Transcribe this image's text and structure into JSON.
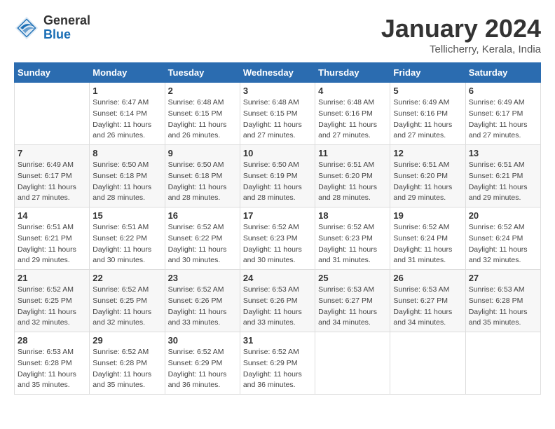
{
  "logo": {
    "general": "General",
    "blue": "Blue"
  },
  "title": "January 2024",
  "subtitle": "Tellicherry, Kerala, India",
  "days_of_week": [
    "Sunday",
    "Monday",
    "Tuesday",
    "Wednesday",
    "Thursday",
    "Friday",
    "Saturday"
  ],
  "weeks": [
    [
      {
        "day": "",
        "sunrise": "",
        "sunset": "",
        "daylight": ""
      },
      {
        "day": "1",
        "sunrise": "Sunrise: 6:47 AM",
        "sunset": "Sunset: 6:14 PM",
        "daylight": "Daylight: 11 hours and 26 minutes."
      },
      {
        "day": "2",
        "sunrise": "Sunrise: 6:48 AM",
        "sunset": "Sunset: 6:15 PM",
        "daylight": "Daylight: 11 hours and 26 minutes."
      },
      {
        "day": "3",
        "sunrise": "Sunrise: 6:48 AM",
        "sunset": "Sunset: 6:15 PM",
        "daylight": "Daylight: 11 hours and 27 minutes."
      },
      {
        "day": "4",
        "sunrise": "Sunrise: 6:48 AM",
        "sunset": "Sunset: 6:16 PM",
        "daylight": "Daylight: 11 hours and 27 minutes."
      },
      {
        "day": "5",
        "sunrise": "Sunrise: 6:49 AM",
        "sunset": "Sunset: 6:16 PM",
        "daylight": "Daylight: 11 hours and 27 minutes."
      },
      {
        "day": "6",
        "sunrise": "Sunrise: 6:49 AM",
        "sunset": "Sunset: 6:17 PM",
        "daylight": "Daylight: 11 hours and 27 minutes."
      }
    ],
    [
      {
        "day": "7",
        "sunrise": "Sunrise: 6:49 AM",
        "sunset": "Sunset: 6:17 PM",
        "daylight": "Daylight: 11 hours and 27 minutes."
      },
      {
        "day": "8",
        "sunrise": "Sunrise: 6:50 AM",
        "sunset": "Sunset: 6:18 PM",
        "daylight": "Daylight: 11 hours and 28 minutes."
      },
      {
        "day": "9",
        "sunrise": "Sunrise: 6:50 AM",
        "sunset": "Sunset: 6:18 PM",
        "daylight": "Daylight: 11 hours and 28 minutes."
      },
      {
        "day": "10",
        "sunrise": "Sunrise: 6:50 AM",
        "sunset": "Sunset: 6:19 PM",
        "daylight": "Daylight: 11 hours and 28 minutes."
      },
      {
        "day": "11",
        "sunrise": "Sunrise: 6:51 AM",
        "sunset": "Sunset: 6:20 PM",
        "daylight": "Daylight: 11 hours and 28 minutes."
      },
      {
        "day": "12",
        "sunrise": "Sunrise: 6:51 AM",
        "sunset": "Sunset: 6:20 PM",
        "daylight": "Daylight: 11 hours and 29 minutes."
      },
      {
        "day": "13",
        "sunrise": "Sunrise: 6:51 AM",
        "sunset": "Sunset: 6:21 PM",
        "daylight": "Daylight: 11 hours and 29 minutes."
      }
    ],
    [
      {
        "day": "14",
        "sunrise": "Sunrise: 6:51 AM",
        "sunset": "Sunset: 6:21 PM",
        "daylight": "Daylight: 11 hours and 29 minutes."
      },
      {
        "day": "15",
        "sunrise": "Sunrise: 6:51 AM",
        "sunset": "Sunset: 6:22 PM",
        "daylight": "Daylight: 11 hours and 30 minutes."
      },
      {
        "day": "16",
        "sunrise": "Sunrise: 6:52 AM",
        "sunset": "Sunset: 6:22 PM",
        "daylight": "Daylight: 11 hours and 30 minutes."
      },
      {
        "day": "17",
        "sunrise": "Sunrise: 6:52 AM",
        "sunset": "Sunset: 6:23 PM",
        "daylight": "Daylight: 11 hours and 30 minutes."
      },
      {
        "day": "18",
        "sunrise": "Sunrise: 6:52 AM",
        "sunset": "Sunset: 6:23 PM",
        "daylight": "Daylight: 11 hours and 31 minutes."
      },
      {
        "day": "19",
        "sunrise": "Sunrise: 6:52 AM",
        "sunset": "Sunset: 6:24 PM",
        "daylight": "Daylight: 11 hours and 31 minutes."
      },
      {
        "day": "20",
        "sunrise": "Sunrise: 6:52 AM",
        "sunset": "Sunset: 6:24 PM",
        "daylight": "Daylight: 11 hours and 32 minutes."
      }
    ],
    [
      {
        "day": "21",
        "sunrise": "Sunrise: 6:52 AM",
        "sunset": "Sunset: 6:25 PM",
        "daylight": "Daylight: 11 hours and 32 minutes."
      },
      {
        "day": "22",
        "sunrise": "Sunrise: 6:52 AM",
        "sunset": "Sunset: 6:25 PM",
        "daylight": "Daylight: 11 hours and 32 minutes."
      },
      {
        "day": "23",
        "sunrise": "Sunrise: 6:52 AM",
        "sunset": "Sunset: 6:26 PM",
        "daylight": "Daylight: 11 hours and 33 minutes."
      },
      {
        "day": "24",
        "sunrise": "Sunrise: 6:53 AM",
        "sunset": "Sunset: 6:26 PM",
        "daylight": "Daylight: 11 hours and 33 minutes."
      },
      {
        "day": "25",
        "sunrise": "Sunrise: 6:53 AM",
        "sunset": "Sunset: 6:27 PM",
        "daylight": "Daylight: 11 hours and 34 minutes."
      },
      {
        "day": "26",
        "sunrise": "Sunrise: 6:53 AM",
        "sunset": "Sunset: 6:27 PM",
        "daylight": "Daylight: 11 hours and 34 minutes."
      },
      {
        "day": "27",
        "sunrise": "Sunrise: 6:53 AM",
        "sunset": "Sunset: 6:28 PM",
        "daylight": "Daylight: 11 hours and 35 minutes."
      }
    ],
    [
      {
        "day": "28",
        "sunrise": "Sunrise: 6:53 AM",
        "sunset": "Sunset: 6:28 PM",
        "daylight": "Daylight: 11 hours and 35 minutes."
      },
      {
        "day": "29",
        "sunrise": "Sunrise: 6:52 AM",
        "sunset": "Sunset: 6:28 PM",
        "daylight": "Daylight: 11 hours and 35 minutes."
      },
      {
        "day": "30",
        "sunrise": "Sunrise: 6:52 AM",
        "sunset": "Sunset: 6:29 PM",
        "daylight": "Daylight: 11 hours and 36 minutes."
      },
      {
        "day": "31",
        "sunrise": "Sunrise: 6:52 AM",
        "sunset": "Sunset: 6:29 PM",
        "daylight": "Daylight: 11 hours and 36 minutes."
      },
      {
        "day": "",
        "sunrise": "",
        "sunset": "",
        "daylight": ""
      },
      {
        "day": "",
        "sunrise": "",
        "sunset": "",
        "daylight": ""
      },
      {
        "day": "",
        "sunrise": "",
        "sunset": "",
        "daylight": ""
      }
    ]
  ]
}
